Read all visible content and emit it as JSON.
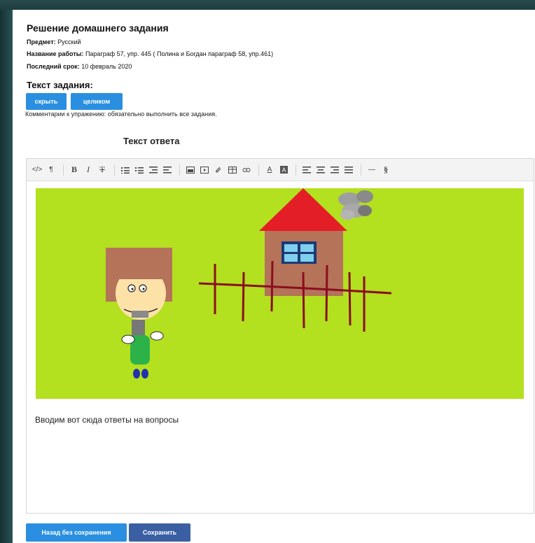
{
  "header": {
    "title": "Решение домашнего задания",
    "subject_label": "Предмет:",
    "subject_value": "Русский",
    "work_label": "Название работы:",
    "work_value": "Параграф 57, упр. 445 ( Полина и Богдан параграф 58, упр.461)",
    "deadline_label": "Последний срок:",
    "deadline_value": "10 февраль 2020"
  },
  "task": {
    "heading": "Текст задания:",
    "hide_label": "скрыть",
    "full_label": "целиком",
    "comment": "Комментарии к упражению: обязательно выполнить все задания."
  },
  "answer": {
    "heading": "Текст ответа",
    "body_text": "Вводим вот сюда ответы на вопросы"
  },
  "toolbar": {
    "html": "</>",
    "paragraph": "¶",
    "bold": "B",
    "italic": "I",
    "strike": "T",
    "font_color": "A",
    "hr": "—",
    "special": "§"
  },
  "footer": {
    "back_label": "Назад без сохранения",
    "save_label": "Сохранить"
  },
  "colors": {
    "primary_blue": "#2a8fe0",
    "save_blue": "#3a5fa3",
    "drawing_bg": "#b3e01f",
    "roof": "#e41e26",
    "house": "#b5735a",
    "fence": "#8b0e1e"
  }
}
